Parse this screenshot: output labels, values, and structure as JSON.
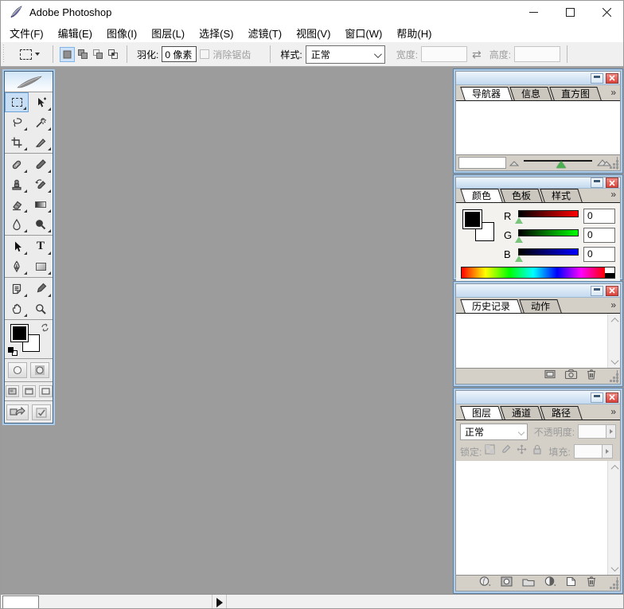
{
  "window": {
    "title": "Adobe Photoshop"
  },
  "menu_bar": {
    "items": [
      "文件(F)",
      "编辑(E)",
      "图像(I)",
      "图层(L)",
      "选择(S)",
      "滤镜(T)",
      "视图(V)",
      "窗口(W)",
      "帮助(H)"
    ]
  },
  "options_bar": {
    "feather_label": "羽化:",
    "feather_value": "0 像素",
    "antialias_label": "消除锯齿",
    "style_label": "样式:",
    "style_value": "正常",
    "width_label": "宽度:",
    "width_value": "",
    "height_label": "高度:",
    "height_value": ""
  },
  "toolbox": {
    "tools": [
      "rectangular-marquee",
      "move",
      "lasso",
      "magic-wand",
      "crop",
      "slice",
      "healing-brush",
      "brush",
      "clone-stamp",
      "history-brush",
      "eraser",
      "gradient",
      "blur",
      "dodge",
      "path-selection",
      "type",
      "pen",
      "shape",
      "notes",
      "eyedropper",
      "hand",
      "zoom"
    ],
    "selected_tool": "rectangular-marquee"
  },
  "panels": {
    "navigator": {
      "tabs": [
        "导航器",
        "信息",
        "直方图"
      ],
      "zoom_value": ""
    },
    "color": {
      "tabs": [
        "颜色",
        "色板",
        "样式"
      ],
      "channels": [
        {
          "label": "R",
          "value": "0"
        },
        {
          "label": "G",
          "value": "0"
        },
        {
          "label": "B",
          "value": "0"
        }
      ]
    },
    "history": {
      "tabs": [
        "历史记录",
        "动作"
      ]
    },
    "layers": {
      "tabs": [
        "图层",
        "通道",
        "路径"
      ],
      "blend_mode": "正常",
      "opacity_label": "不透明度:",
      "opacity_value": "",
      "lock_label": "锁定:",
      "fill_label": "填充:",
      "fill_value": ""
    }
  },
  "status_bar": {
    "zoom_value": ""
  },
  "colors": {
    "workspace": "#9c9c9c",
    "panel_chrome": "#d4d0c8",
    "panel_border_blue": "#5f83a7",
    "selection_highlight": "#c8def5",
    "close_button_red": "#d8423a",
    "slider_thumb_green": "#4caf50"
  }
}
